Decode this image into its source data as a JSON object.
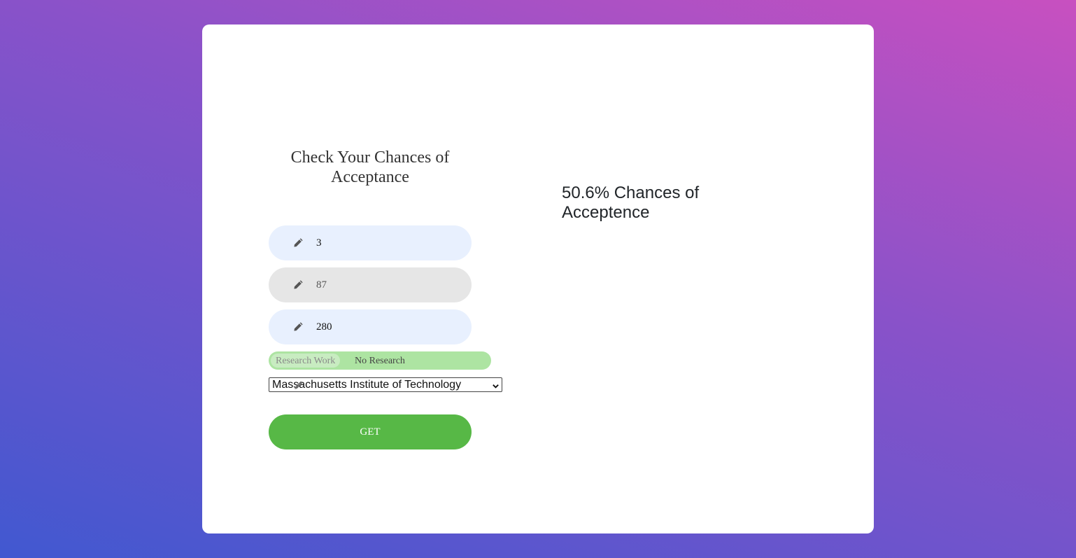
{
  "form": {
    "title": "Check Your Chances of Acceptance",
    "fields": [
      {
        "value": "3",
        "icon": "pencil-icon"
      },
      {
        "value": "87",
        "icon": "pencil-icon"
      },
      {
        "value": "280",
        "icon": "pencil-icon"
      }
    ],
    "research_toggle": {
      "option_on": "Research Work",
      "option_off": "No Research"
    },
    "university_select": {
      "selected": "Massachusetts Institute of Technology"
    },
    "submit_label": "GET"
  },
  "result": {
    "text": "50.6% Chances of Acceptence"
  },
  "colors": {
    "accent_green": "#57b846",
    "toggle_green": "#ade4a2",
    "field_blue": "#e8f0fe",
    "field_gray": "#e6e6e6",
    "gradient_start": "#c850c0",
    "gradient_end": "#4158d0"
  }
}
